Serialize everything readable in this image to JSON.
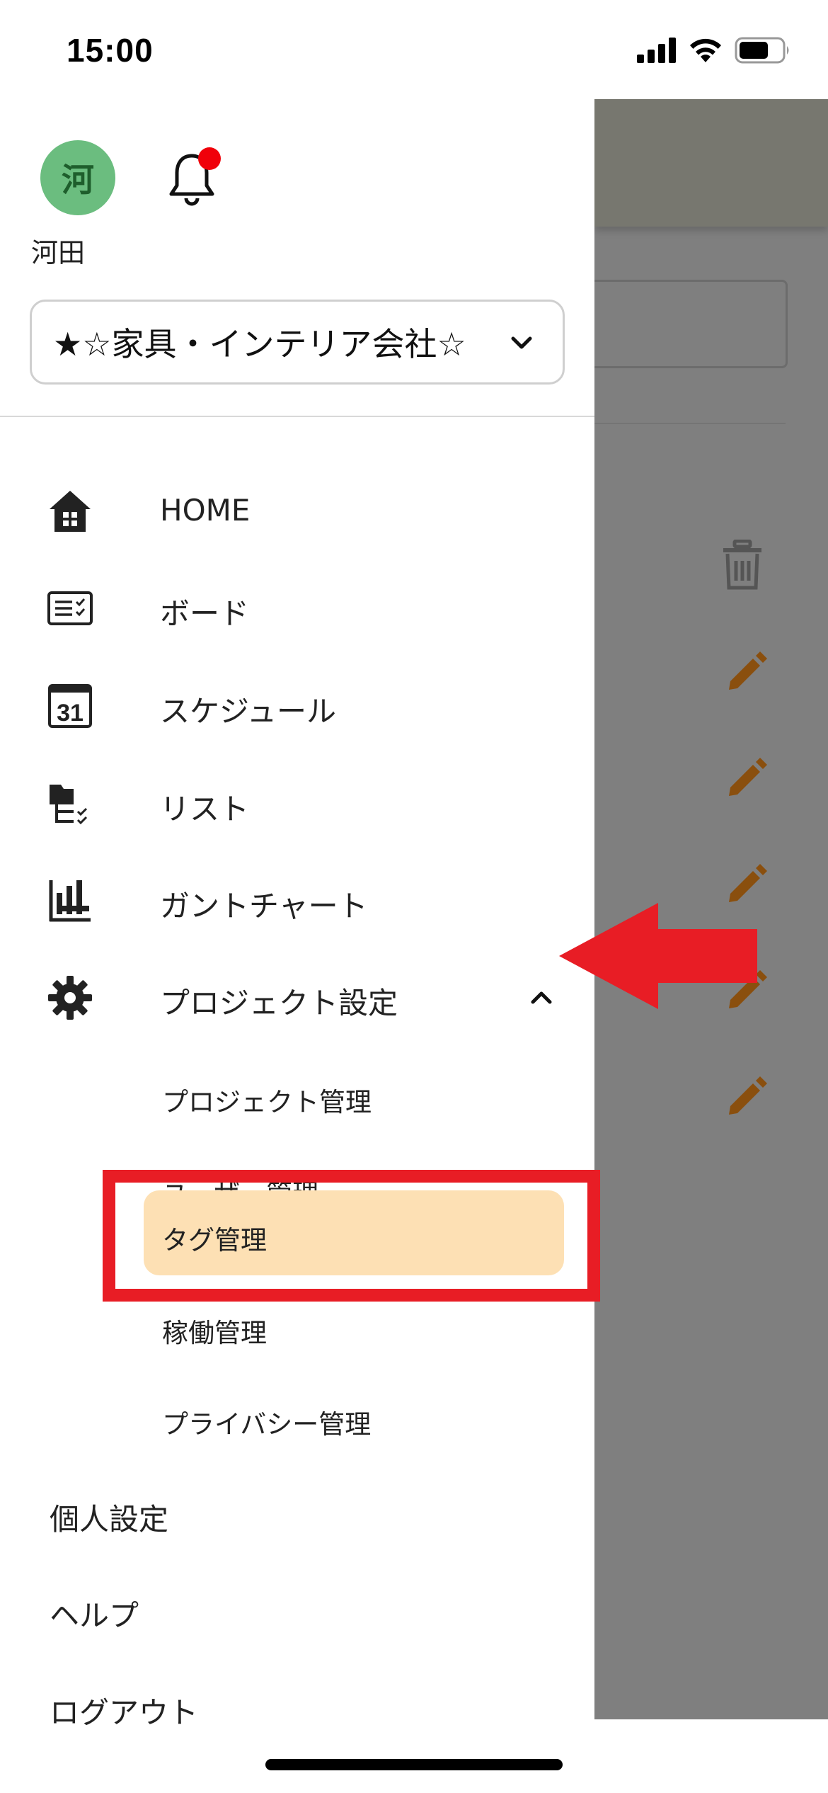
{
  "status_bar": {
    "time": "15:00"
  },
  "user": {
    "avatar_initial": "河",
    "name": "河田"
  },
  "project_select": {
    "value": "★☆家具・インテリア会社☆"
  },
  "nav": {
    "home": "HOME",
    "board": "ボード",
    "schedule": "スケジュール",
    "list": "リスト",
    "gantt": "ガントチャート",
    "project_settings": "プロジェクト設定"
  },
  "sub_nav": {
    "project_management": "プロジェクト管理",
    "user_management": "ユーザー管理",
    "tag_management": "タグ管理",
    "operation_management": "稼働管理",
    "privacy_management": "プライバシー管理"
  },
  "footer_nav": {
    "personal_settings": "個人設定",
    "help": "ヘルプ",
    "logout": "ログアウト"
  },
  "icons": {
    "schedule_day": "31"
  },
  "colors": {
    "accent_active": "#fde0b4",
    "avatar_bg": "#6bbd7f",
    "notification": "#f0000a",
    "annotation": "#e81d25",
    "edit_icon": "#8a4f0e"
  }
}
